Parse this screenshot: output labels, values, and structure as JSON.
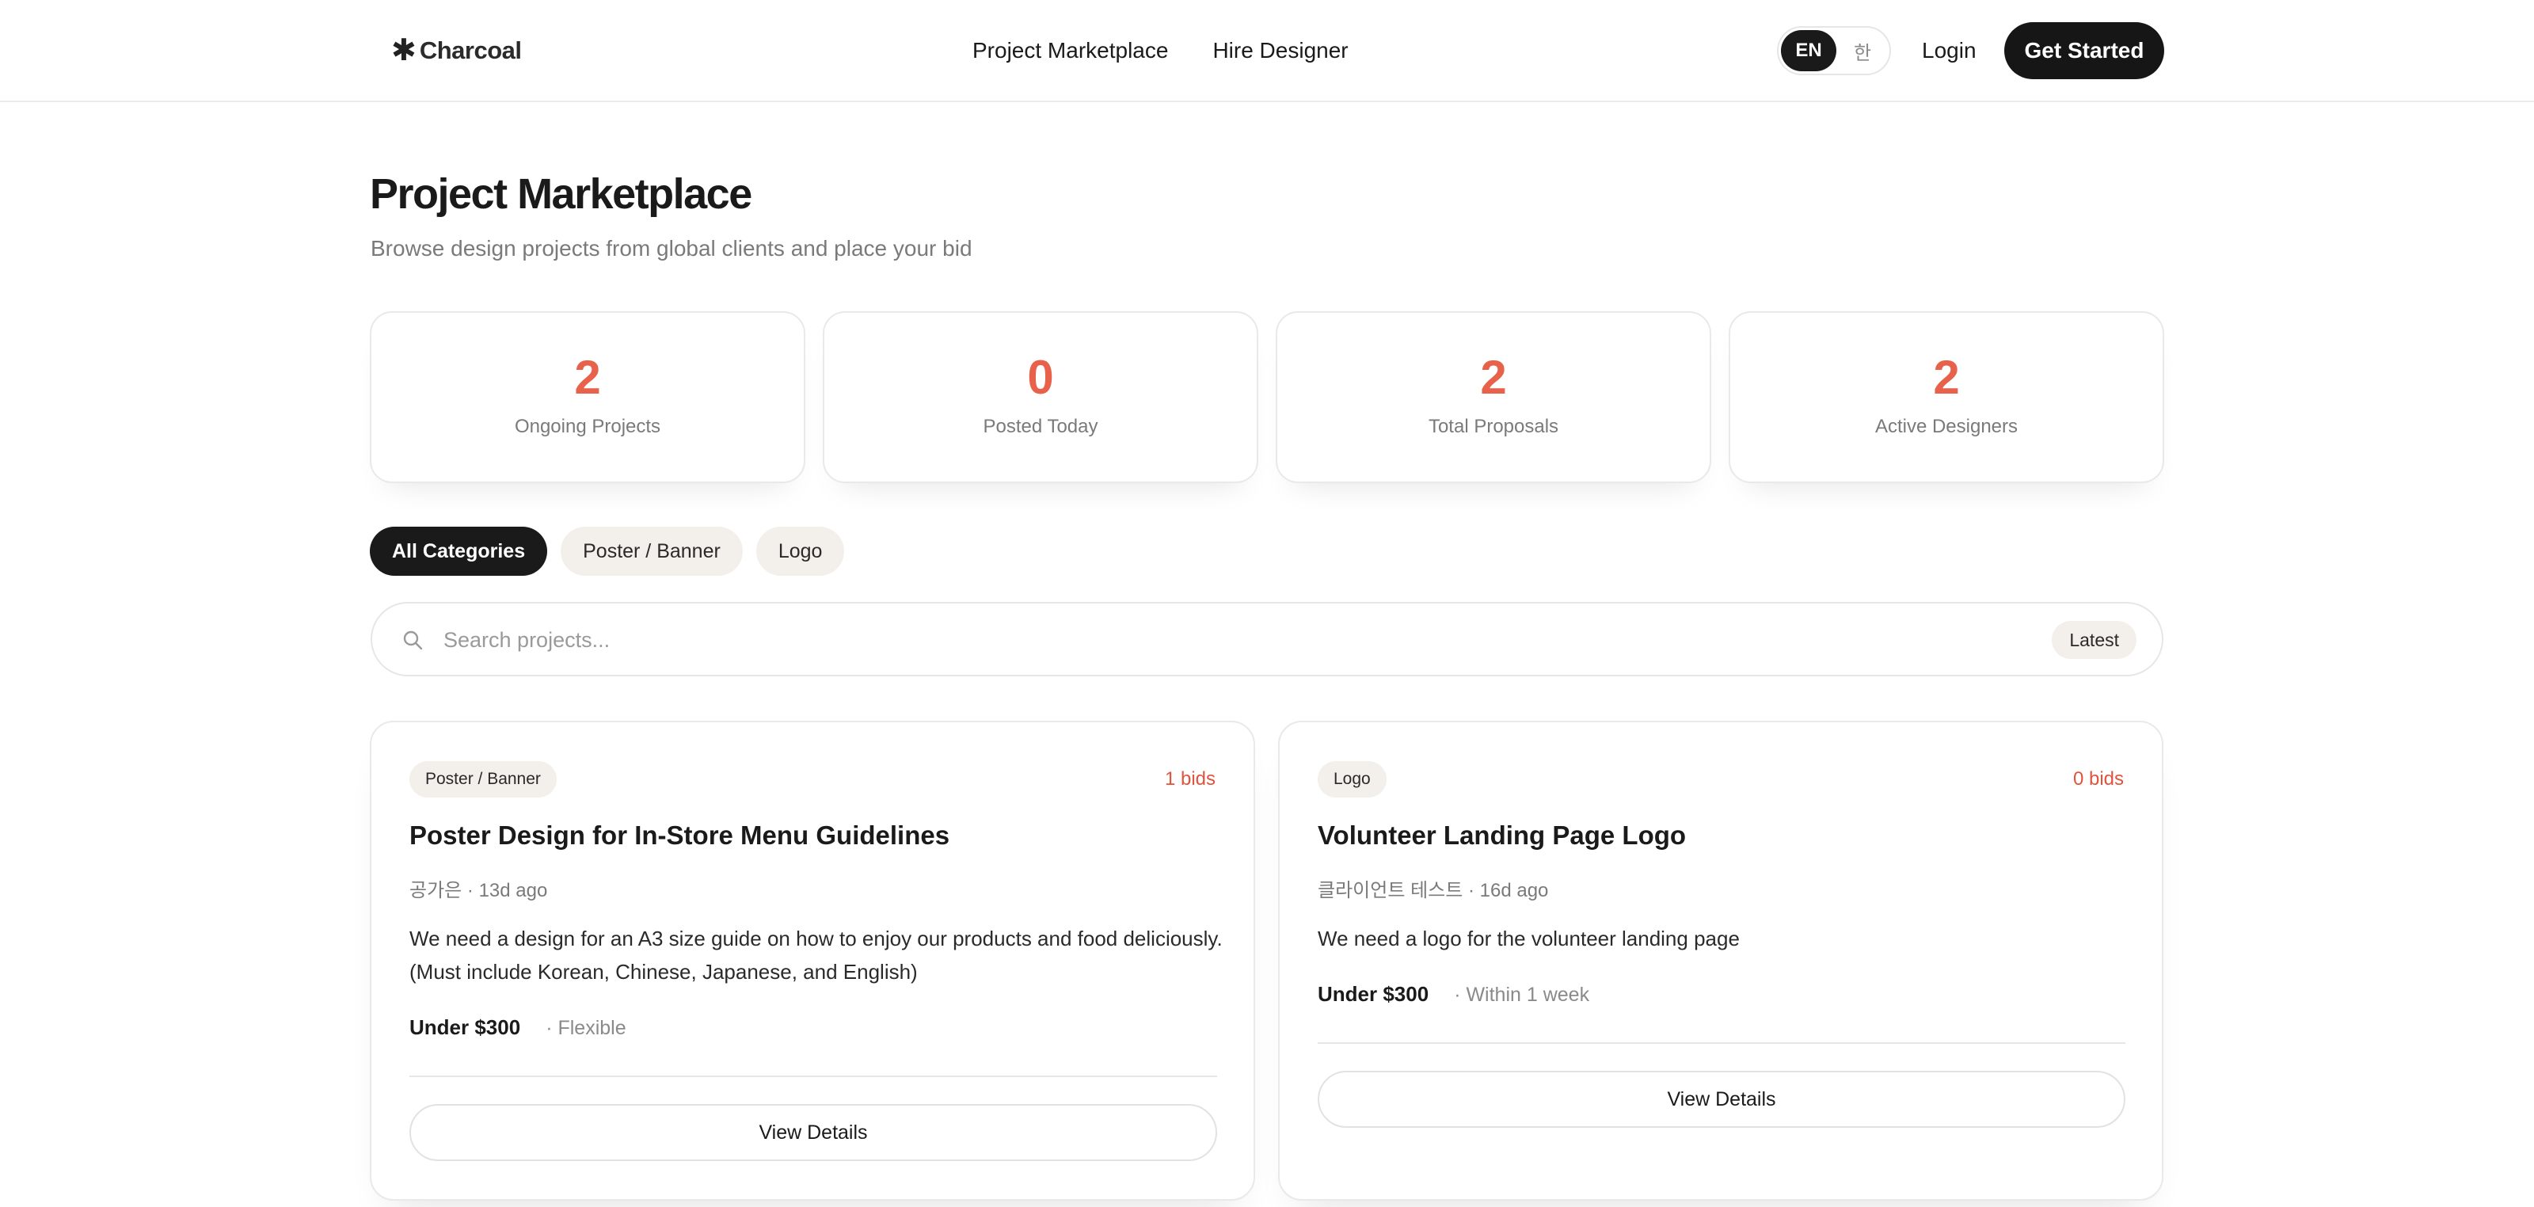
{
  "header": {
    "logo_icon": "✱",
    "logo_text": "Charcoal",
    "nav": [
      "Project Marketplace",
      "Hire Designer"
    ],
    "lang_en": "EN",
    "lang_ko": "한",
    "login": "Login",
    "get_started": "Get Started"
  },
  "page": {
    "title": "Project Marketplace",
    "subtitle": "Browse design projects from global clients and place your bid"
  },
  "stats": [
    {
      "value": "2",
      "label": "Ongoing Projects"
    },
    {
      "value": "0",
      "label": "Posted Today"
    },
    {
      "value": "2",
      "label": "Total Proposals"
    },
    {
      "value": "2",
      "label": "Active Designers"
    }
  ],
  "categories": [
    "All Categories",
    "Poster / Banner",
    "Logo"
  ],
  "search": {
    "placeholder": "Search projects...",
    "sort": "Latest"
  },
  "projects": [
    {
      "category": "Poster / Banner",
      "bids": "1 bids",
      "title": "Poster Design for In-Store Menu Guidelines",
      "meta": "공가은 · 13d ago",
      "description": "We need a design for an A3 size guide on how to enjoy our products and food deliciously. (Must include Korean, Chinese, Japanese, and English)",
      "budget": "Under $300",
      "timeline": "· Flexible",
      "cta": "View Details"
    },
    {
      "category": "Logo",
      "bids": "0 bids",
      "title": "Volunteer Landing Page Logo",
      "meta": "클라이언트 테스트 · 16d ago",
      "description": "We need a logo for the volunteer landing page",
      "budget": "Under $300",
      "timeline": "· Within 1 week",
      "cta": "View Details"
    }
  ],
  "colors": {
    "accent": "#e8614a",
    "dark": "#1a1a1a",
    "chip_bg": "#f3efea"
  }
}
